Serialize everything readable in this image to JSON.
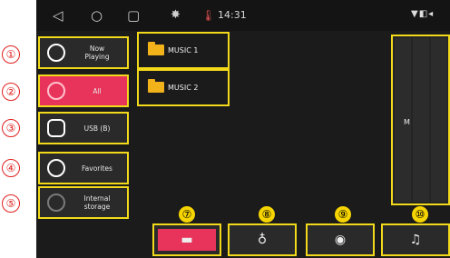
{
  "statusbar": {
    "back_icon": "◁",
    "home_icon": "○",
    "recents_icon": "▢",
    "brightness_icon": "✸",
    "thermometer_icon": "🌡",
    "time": "14:31",
    "status_right": "▼◧◂"
  },
  "callouts": [
    "①",
    "②",
    "③",
    "④",
    "⑤",
    "⑦",
    "⑧",
    "⑨",
    "⑩"
  ],
  "sidebar": {
    "items": [
      {
        "label": "Now\nPlaying",
        "icon": "now-playing-icon"
      },
      {
        "label": "All",
        "icon": "all-icon",
        "active": true
      },
      {
        "label": "USB (B)",
        "icon": "usb-icon"
      },
      {
        "label": "Favorites",
        "icon": "heart-icon"
      },
      {
        "label": "Internal\nstorage",
        "icon": "storage-icon"
      }
    ]
  },
  "folders": [
    {
      "label": "MUSIC 1"
    },
    {
      "label": "MUSIC 2"
    }
  ],
  "alphabet_index": {
    "visible_letter": "M"
  },
  "bottom_tabs": [
    {
      "name": "folders",
      "icon": "▬",
      "active": true
    },
    {
      "name": "artists",
      "icon": "♁"
    },
    {
      "name": "albums",
      "icon": "◉"
    },
    {
      "name": "songs",
      "icon": "♫"
    }
  ],
  "colors": {
    "accent": "#e8345a",
    "highlight_border": "#f2da1a",
    "callout_red": "#e0211f"
  }
}
